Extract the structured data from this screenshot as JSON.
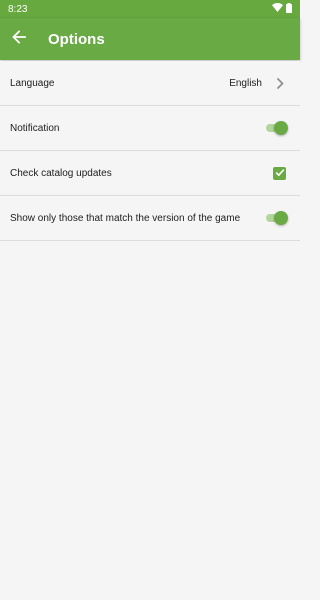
{
  "status_bar": {
    "time": "8:23",
    "icons": [
      "wifi-icon",
      "battery-icon"
    ]
  },
  "app_bar": {
    "back_icon": "arrow-left-icon",
    "title": "Options",
    "background": "#6aaa45"
  },
  "settings": {
    "language": {
      "label": "Language",
      "value": "English"
    },
    "notification": {
      "label": "Notification",
      "enabled": true
    },
    "catalog_updates": {
      "label": "Check catalog updates",
      "checked": true
    },
    "match_version": {
      "label": "Show only those that match the version of the game",
      "enabled": true
    }
  },
  "colors": {
    "accent": "#6aaa45",
    "status_bar": "#67a83f",
    "background": "#f5f5f5",
    "divider": "#dcdcdc"
  }
}
